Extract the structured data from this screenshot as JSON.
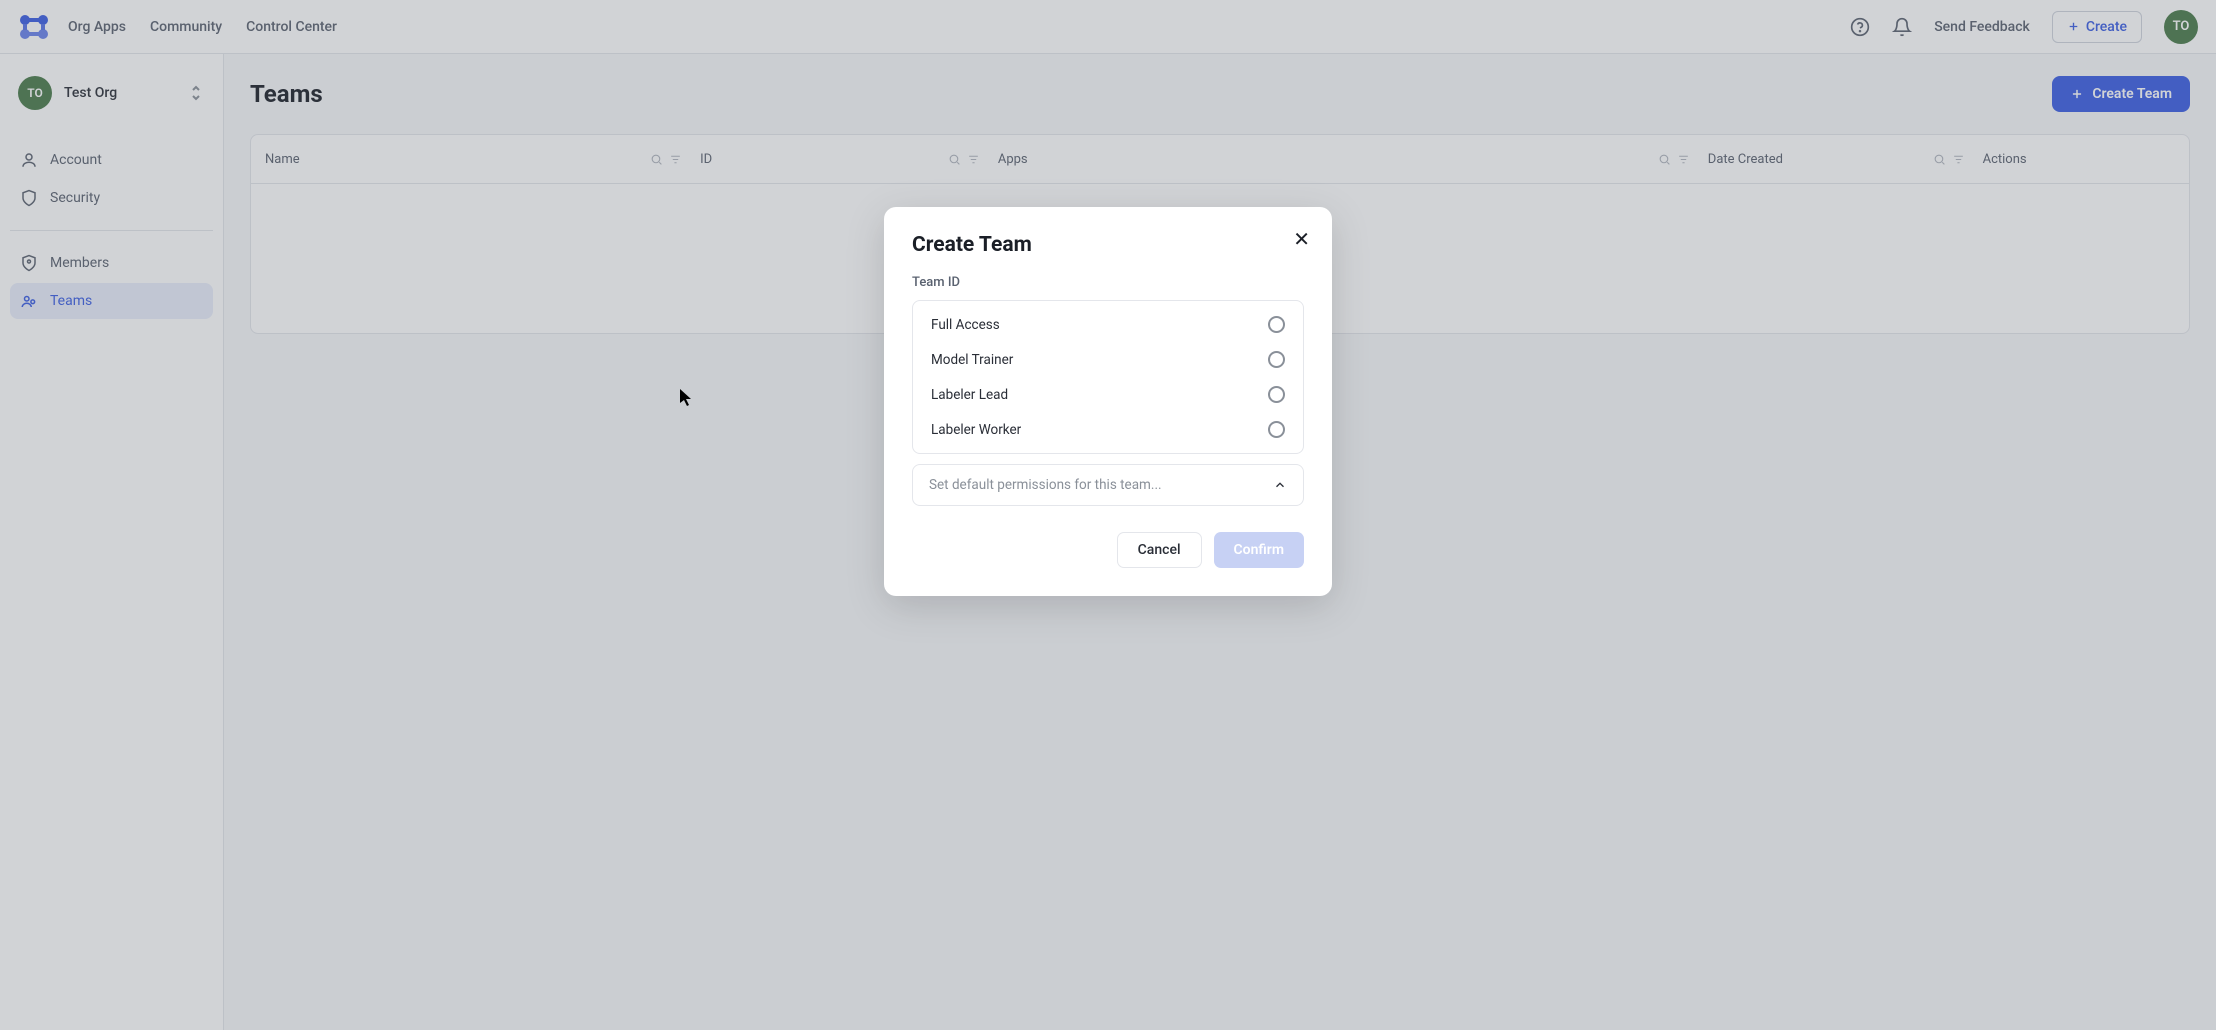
{
  "nav": {
    "links": [
      "Org Apps",
      "Community",
      "Control Center"
    ],
    "feedback": "Send Feedback",
    "create": "Create",
    "avatar_initials": "TO"
  },
  "sidebar": {
    "org_initials": "TO",
    "org_name": "Test Org",
    "items": [
      {
        "label": "Account"
      },
      {
        "label": "Security"
      },
      {
        "label": "Members"
      },
      {
        "label": "Teams"
      }
    ]
  },
  "page": {
    "title": "Teams",
    "create_team_btn": "Create Team",
    "columns": {
      "name": "Name",
      "id": "ID",
      "apps": "Apps",
      "date": "Date Created",
      "actions": "Actions"
    }
  },
  "modal": {
    "title": "Create Team",
    "field_label": "Team ID",
    "options": [
      "Full Access",
      "Model Trainer",
      "Labeler Lead",
      "Labeler Worker"
    ],
    "dropdown_placeholder": "Set default permissions for this team...",
    "cancel": "Cancel",
    "confirm": "Confirm"
  },
  "colors": {
    "primary": "#3B5EE3",
    "avatar_bg": "#4a7a4a"
  }
}
